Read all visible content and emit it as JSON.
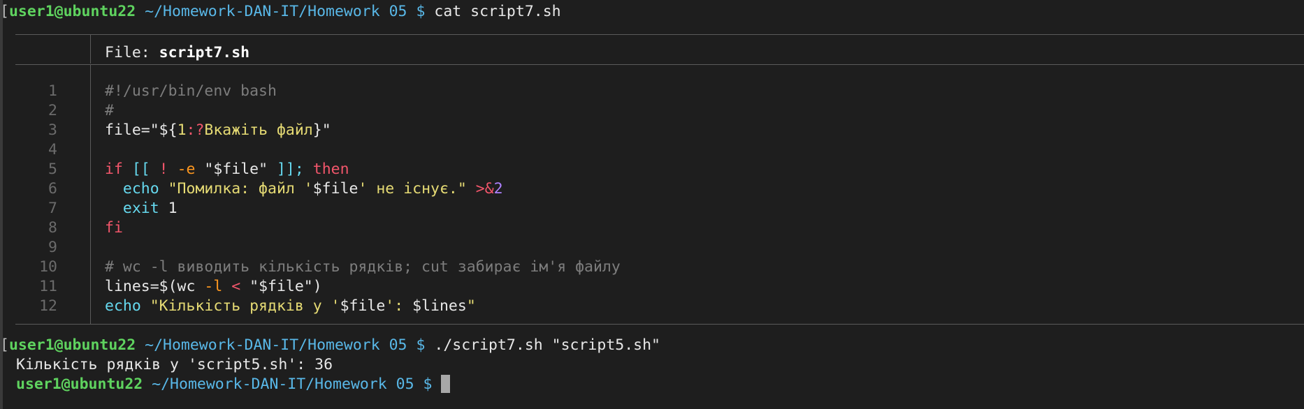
{
  "terminal": {
    "prompt": {
      "user_host": "user1@ubuntu22",
      "path": "~/Homework-DAN-IT/Homework 05",
      "dollar": "$"
    },
    "commands": [
      "cat script7.sh",
      "./script7.sh \"script5.sh\""
    ],
    "output_line": "Кількість рядків у 'script5.sh': 36"
  },
  "file_view": {
    "header_prefix": "File: ",
    "file_name": "script7.sh",
    "line_numbers": [
      "1",
      "2",
      "3",
      "4",
      "5",
      "6",
      "7",
      "8",
      "9",
      "10",
      "11",
      "12"
    ],
    "code": {
      "l1": "#!/usr/bin/env bash",
      "l2": "#",
      "l3_a": "file=",
      "l3_b": "\"${",
      "l3_c": "1",
      "l3_d": ":?",
      "l3_e": "Вкажіть файл",
      "l3_f": "}\"",
      "l5_if": "if",
      "l5_br1": " [[ ",
      "l5_not": "!",
      "l5_flag": " -e",
      "l5_str": " \"$file\"",
      "l5_br2": " ]];",
      "l5_then": " then",
      "l6_indent": "  ",
      "l6_echo": "echo",
      "l6_str_a": " \"Помилка: файл '",
      "l6_var": "$file",
      "l6_str_b": "' не існує.\"",
      "l6_redir": " >&",
      "l6_num": "2",
      "l7_indent": "  ",
      "l7_exit": "exit",
      "l7_num": " 1",
      "l8_fi": "fi",
      "l10": "# wc -l виводить кількість рядків; cut забирає ім'я файлу",
      "l11_a": "lines=",
      "l11_b": "$(wc",
      "l11_flag": " -l",
      "l11_lt": " <",
      "l11_c": " \"$file\")",
      "l12_echo": "echo",
      "l12_str_a": " \"Кількість рядків у '",
      "l12_var": "$file",
      "l12_str_b": "': ",
      "l12_var2": "$lines",
      "l12_str_c": "\""
    }
  },
  "colors": {
    "background": "#1e1e1e",
    "prompt_user": "#5fd35f",
    "prompt_path": "#59b8e8",
    "keyword": "#f2566b",
    "string": "#e6db74",
    "builtin": "#66d9ef",
    "comment": "#7d7d7d",
    "flag": "#fd971f",
    "number": "#ae81ff"
  }
}
